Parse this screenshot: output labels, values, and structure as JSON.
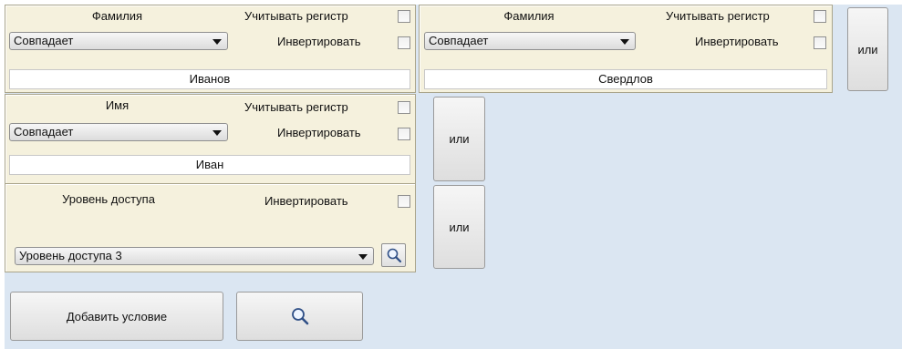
{
  "filters": [
    {
      "title": "Фамилия",
      "case_label": "Учитывать регистр",
      "invert_label": "Инвертировать",
      "match_mode": "Совпадает",
      "value": "Иванов"
    },
    {
      "title": "Фамилия",
      "case_label": "Учитывать регистр",
      "invert_label": "Инвертировать",
      "match_mode": "Совпадает",
      "value": "Свердлов"
    },
    {
      "title": "Имя",
      "case_label": "Учитывать регистр",
      "invert_label": "Инвертировать",
      "match_mode": "Совпадает",
      "value": "Иван"
    },
    {
      "title": "Уровень доступа",
      "invert_label": "Инвертировать",
      "access_level": "Уровень доступа 3"
    }
  ],
  "or_buttons": [
    "или",
    "или",
    "или"
  ],
  "actions": {
    "add_condition_label": "Добавить условие",
    "search_icon": "search-icon"
  }
}
